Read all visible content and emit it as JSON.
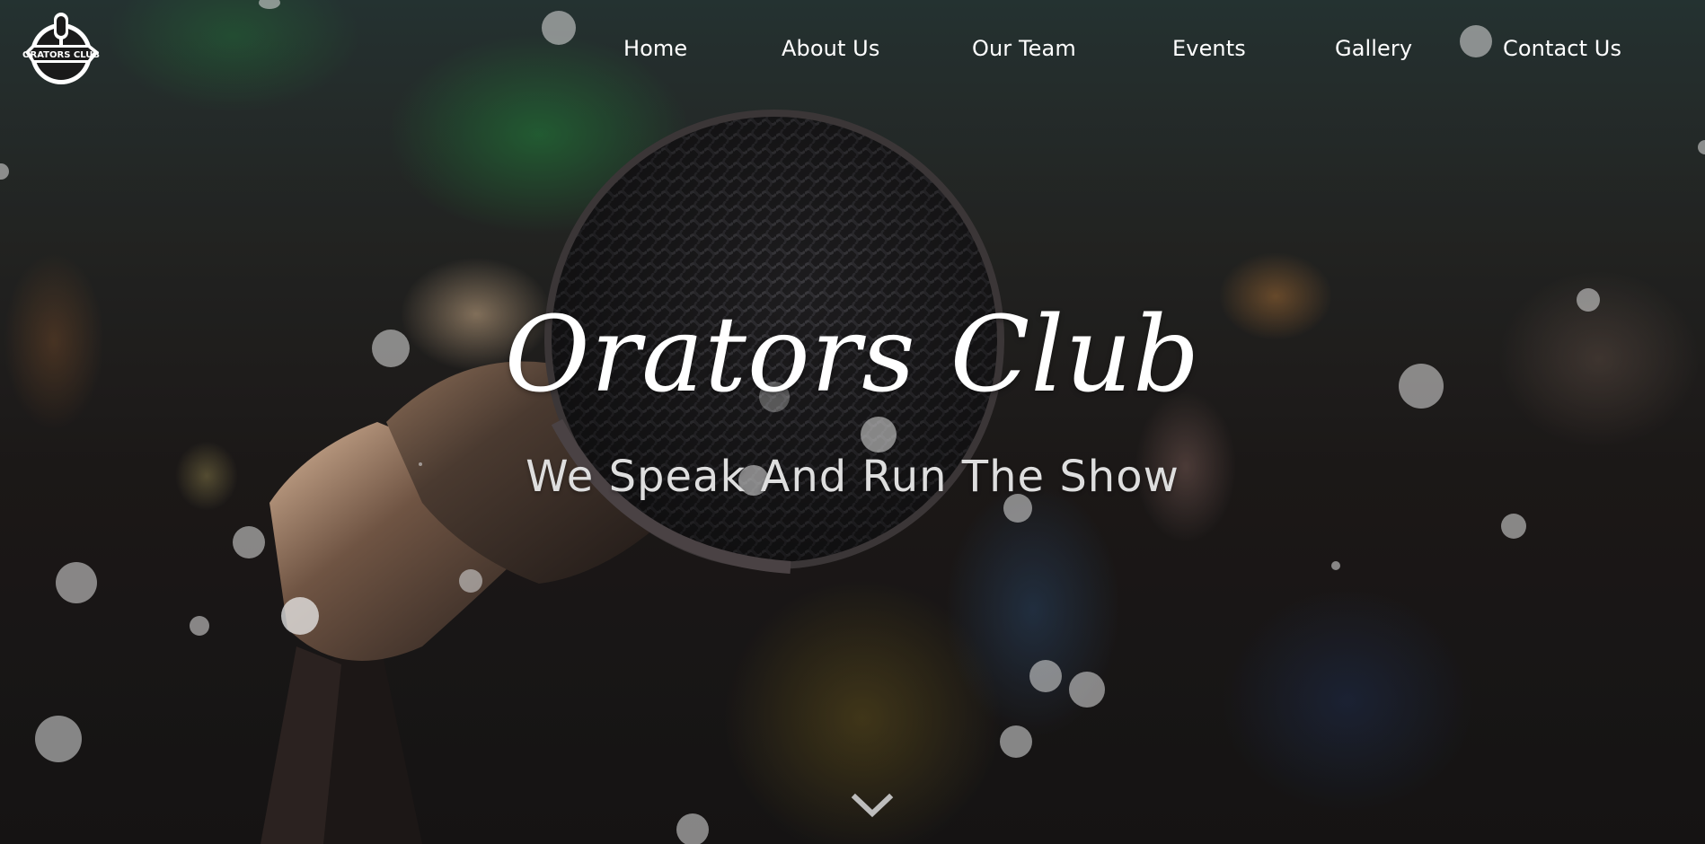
{
  "brand": {
    "logo_text": "ORATORS CLUB",
    "logo_icon": "microphone-logo-icon"
  },
  "nav": {
    "items": [
      {
        "label": "Home"
      },
      {
        "label": "About Us"
      },
      {
        "label": "Our Team"
      },
      {
        "label": "Events"
      },
      {
        "label": "Gallery"
      },
      {
        "label": "Contact Us"
      }
    ]
  },
  "hero": {
    "title": "Orators Club",
    "subtitle": "We Speak And Run The Show",
    "scroll_icon": "chevron-down-icon"
  },
  "colors": {
    "text": "#ffffff",
    "subtitle": "#dedede",
    "bubble": "rgba(210,210,210,0.6)"
  }
}
